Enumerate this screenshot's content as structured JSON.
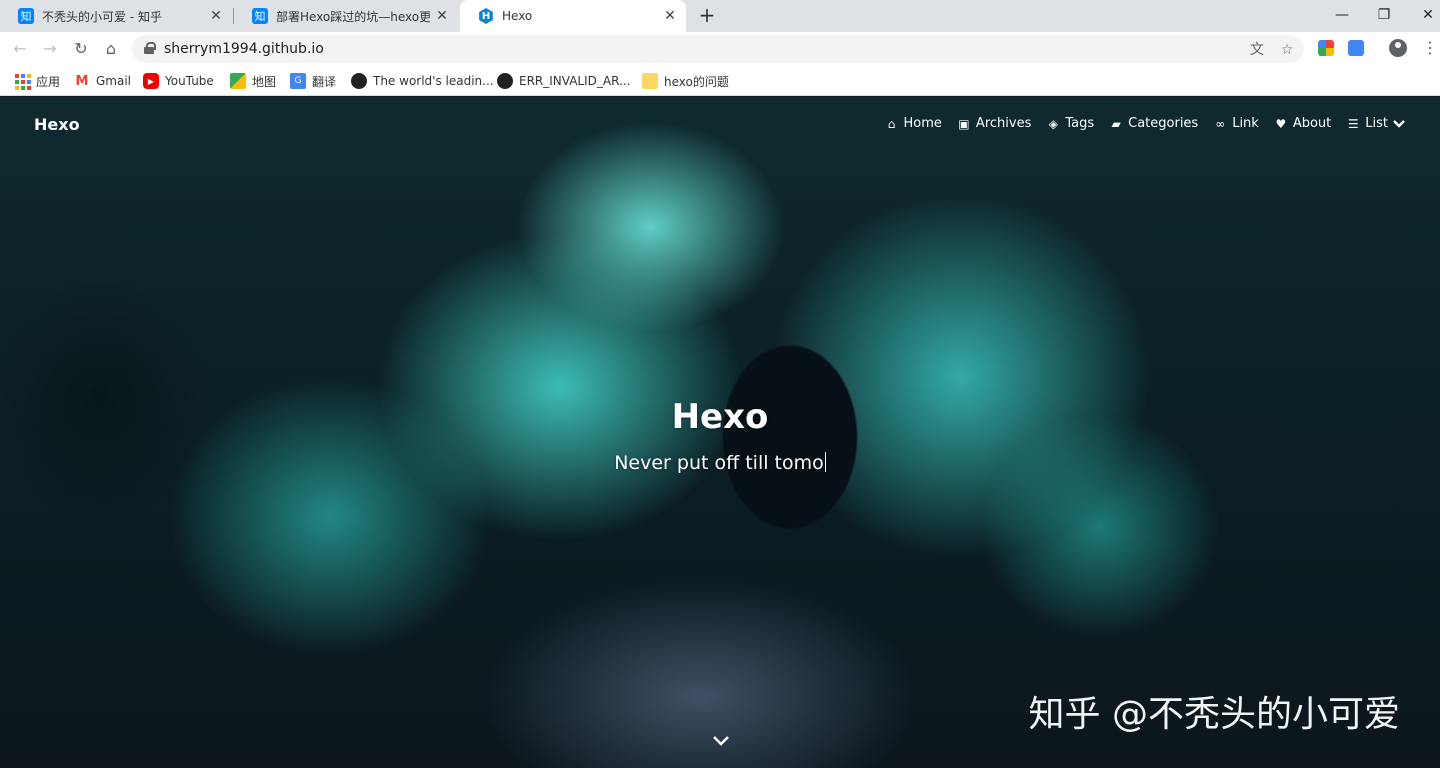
{
  "browser": {
    "tabs": [
      {
        "title": "不秃头的小可爱 - 知乎",
        "favicon": "知",
        "active": false
      },
      {
        "title": "部署Hexo踩过的坑—hexo更换主",
        "favicon": "知",
        "active": false
      },
      {
        "title": "Hexo",
        "favicon": "H",
        "active": true
      }
    ],
    "new_tab": "+",
    "window_controls": {
      "minimize": "—",
      "restore": "❐",
      "close": "✕"
    },
    "url": "sherrym1994.github.io",
    "bookmarks": [
      {
        "label": "应用",
        "icon": "apps-grid-icon"
      },
      {
        "label": "Gmail",
        "icon": "gmail-icon"
      },
      {
        "label": "YouTube",
        "icon": "youtube-icon"
      },
      {
        "label": "地图",
        "icon": "maps-icon"
      },
      {
        "label": "翻译",
        "icon": "translate-icon"
      },
      {
        "label": "The world's leadin...",
        "icon": "github-icon"
      },
      {
        "label": "ERR_INVALID_AR...",
        "icon": "github-icon"
      },
      {
        "label": "hexo的问题",
        "icon": "folder-icon"
      }
    ]
  },
  "site": {
    "logo": "Hexo",
    "nav": [
      {
        "label": "Home",
        "icon": "home-icon"
      },
      {
        "label": "Archives",
        "icon": "archive-icon"
      },
      {
        "label": "Tags",
        "icon": "tags-icon"
      },
      {
        "label": "Categories",
        "icon": "folder-open-icon"
      },
      {
        "label": "Link",
        "icon": "link-icon"
      },
      {
        "label": "About",
        "icon": "heart-icon"
      },
      {
        "label": "List",
        "icon": "list-icon"
      }
    ],
    "hero_title": "Hexo",
    "hero_subtitle": "Never put off till tomo",
    "watermark": "知乎 @不秃头的小可爱"
  },
  "colors": {
    "accent": "#0e83cd",
    "zhihu": "#0084ff",
    "smoke": "#46d7cd"
  }
}
